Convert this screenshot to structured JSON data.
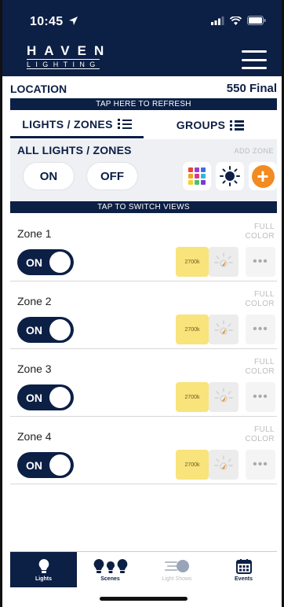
{
  "status_bar": {
    "time": "10:45"
  },
  "brand": {
    "name": "HAVEN",
    "sub": "LIGHTING"
  },
  "location": {
    "label": "LOCATION",
    "value": "550 Final",
    "refresh_hint": "TAP HERE TO REFRESH"
  },
  "tabs": [
    {
      "label": "LIGHTS / ZONES",
      "active": true
    },
    {
      "label": "GROUPS",
      "active": false
    }
  ],
  "all_lights": {
    "title": "ALL LIGHTS / ZONES",
    "add_zone": "ADD ZONE",
    "on_label": "ON",
    "off_label": "OFF"
  },
  "switch_hint": "TAP TO SWITCH VIEWS",
  "zones": [
    {
      "name": "Zone 1",
      "mode_line1": "FULL",
      "mode_line2": "COLOR",
      "toggle": "ON",
      "kelvin": "2700k"
    },
    {
      "name": "Zone 2",
      "mode_line1": "FULL",
      "mode_line2": "COLOR",
      "toggle": "ON",
      "kelvin": "2700k"
    },
    {
      "name": "Zone 3",
      "mode_line1": "FULL",
      "mode_line2": "COLOR",
      "toggle": "ON",
      "kelvin": "2700k"
    },
    {
      "name": "Zone 4",
      "mode_line1": "FULL",
      "mode_line2": "COLOR",
      "toggle": "ON",
      "kelvin": "2700k"
    }
  ],
  "more_glyph": "•••",
  "nav": [
    {
      "label": "Lights",
      "icon": "bulb-icon",
      "active": true
    },
    {
      "label": "Scenes",
      "icon": "bulbs-icon",
      "active": false
    },
    {
      "label": "Light Shows",
      "icon": "light-shows-icon",
      "active": false,
      "dim": true
    },
    {
      "label": "Events",
      "icon": "calendar-icon",
      "active": false
    }
  ],
  "colors": {
    "navy": "#0c1f45",
    "accent_orange": "#f28b21",
    "kelvin_yellow": "#f9e37b"
  }
}
